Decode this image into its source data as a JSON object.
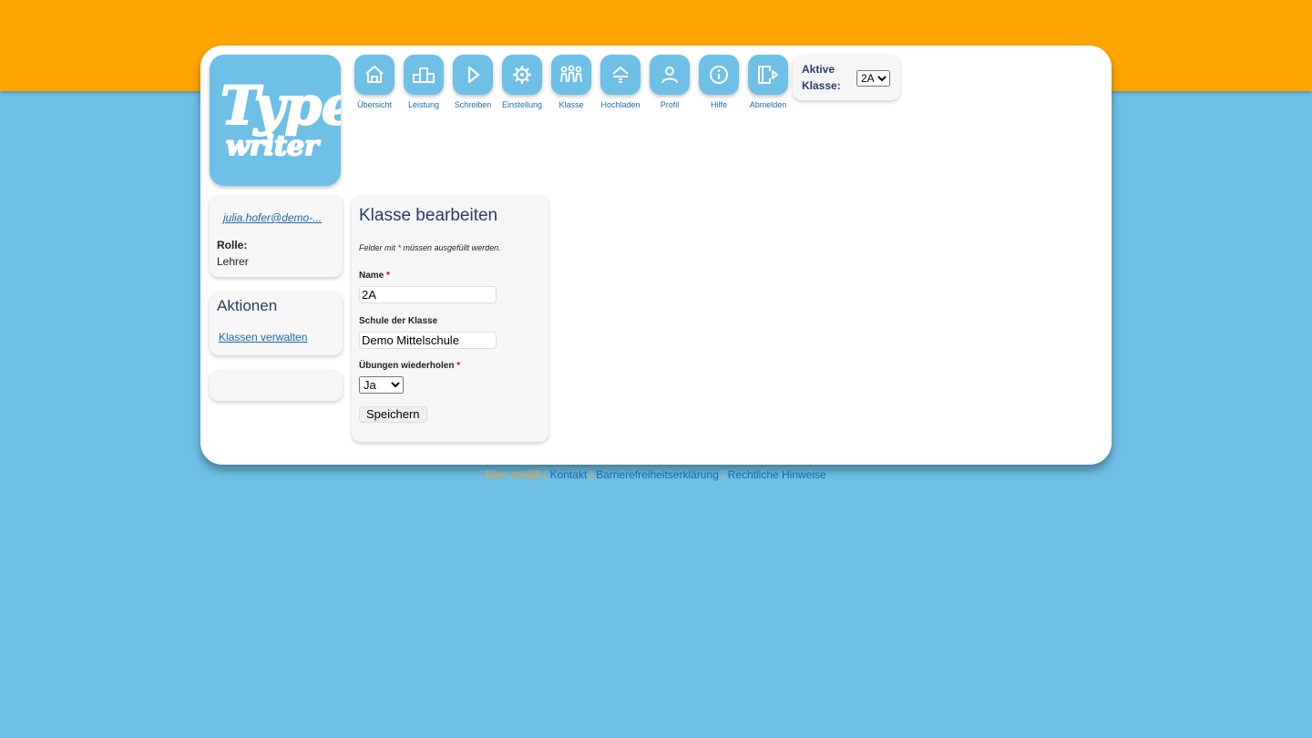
{
  "colors": {
    "accent": "#ffa500",
    "tile": "#6ec0e6",
    "link": "#1a6aa8",
    "heading": "#2a3a6a"
  },
  "logo": {
    "line1": "Type",
    "line2": "writer"
  },
  "nav": [
    {
      "label": "Übersicht",
      "icon": "home-icon"
    },
    {
      "label": "Leistung",
      "icon": "stats-icon"
    },
    {
      "label": "Schreiben",
      "icon": "play-icon"
    },
    {
      "label": "Einstellung",
      "icon": "gear-icon"
    },
    {
      "label": "Klasse",
      "icon": "group-icon"
    },
    {
      "label": "Hochladen",
      "icon": "upload-icon"
    },
    {
      "label": "Profil",
      "icon": "user-icon"
    },
    {
      "label": "Hilfe",
      "icon": "info-icon"
    },
    {
      "label": "Abmelden",
      "icon": "logout-icon"
    }
  ],
  "active_class": {
    "label": "Aktive Klasse:",
    "value": "2A"
  },
  "user": {
    "email": "julia.hofer@demo-...",
    "role_label": "Rolle:",
    "role": "Lehrer"
  },
  "actions": {
    "title": "Aktionen",
    "link": "Klassen verwalten"
  },
  "form": {
    "title": "Klasse bearbeiten",
    "hint_before": "Felder mit ",
    "hint_star": "*",
    "hint_after": " müssen ausgefüllt werden.",
    "name_label": "Name",
    "name_value": "2A",
    "school_label": "Schule der Klasse",
    "school_value": "Demo Mittelschule",
    "repeat_label": "Übungen wiederholen",
    "repeat_value": "Ja",
    "required_mark": "*",
    "save_label": "Speichern"
  },
  "footer": {
    "info": "[dev, mobil]",
    "sep": "|",
    "links": [
      "Kontakt",
      "Barrierefreiheitserklärung",
      "Rechtliche Hinweise"
    ]
  }
}
